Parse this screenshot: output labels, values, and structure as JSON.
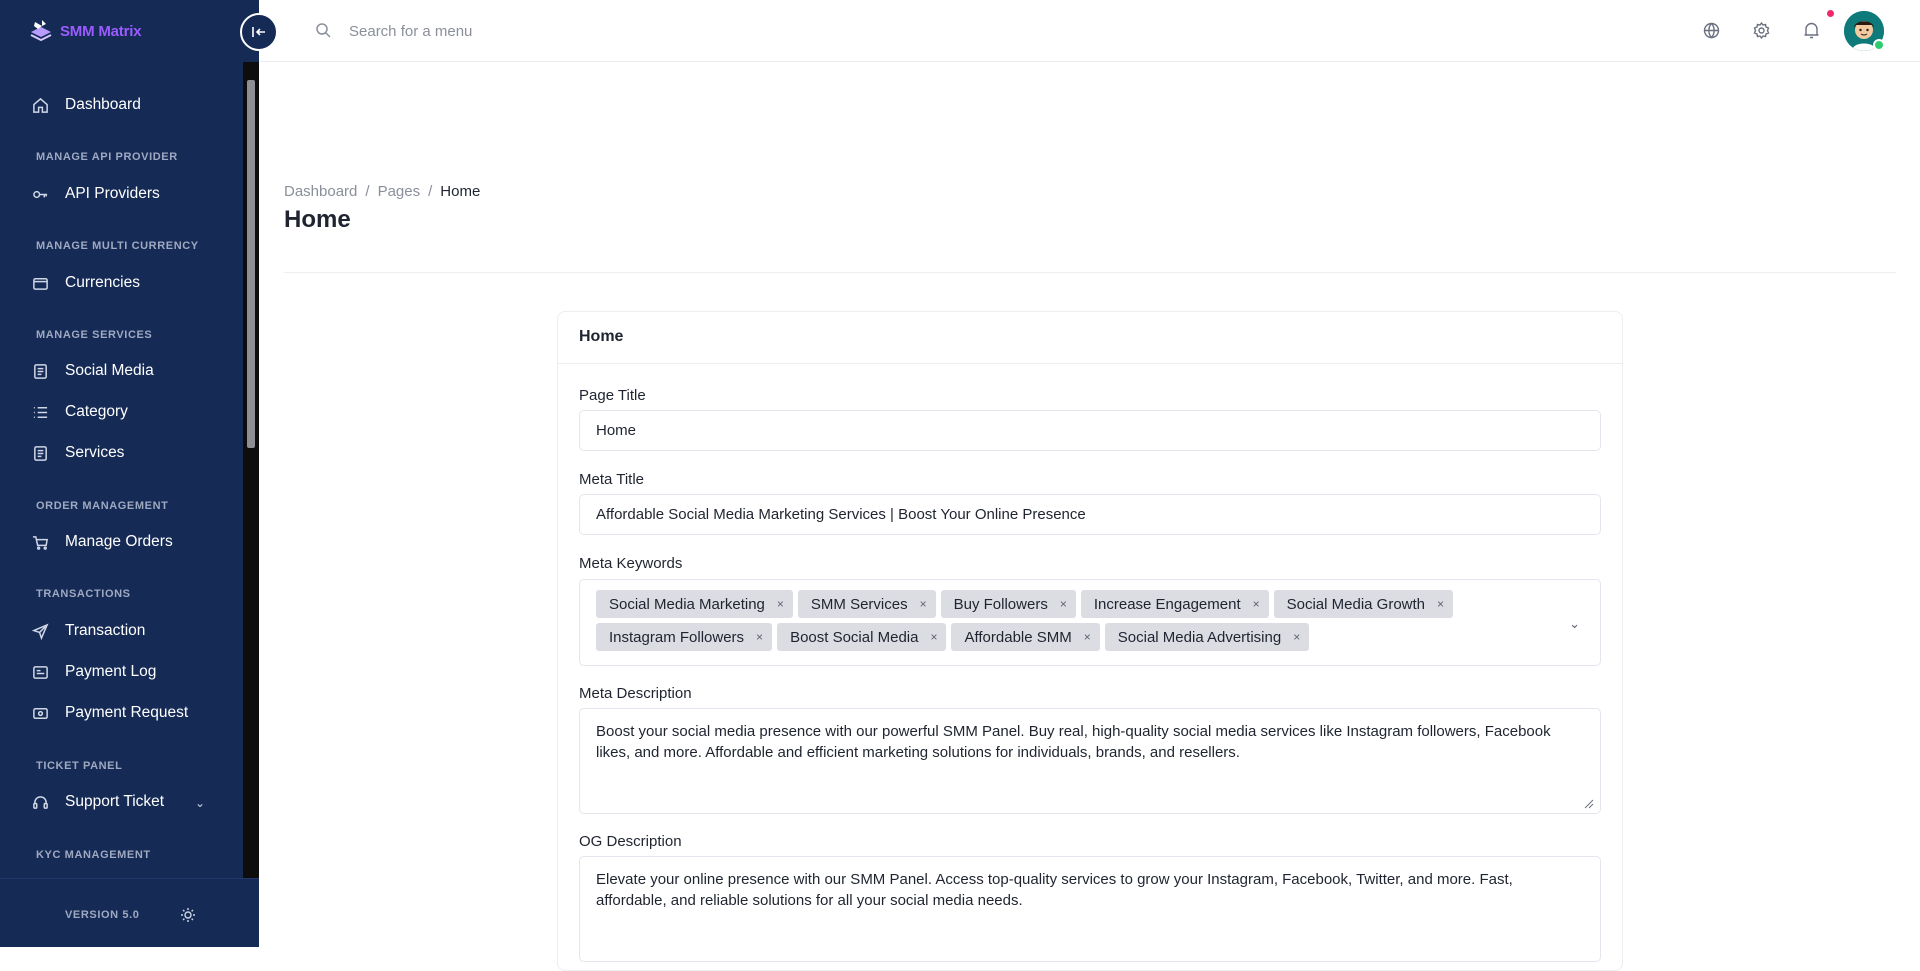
{
  "brand": {
    "name": "SMM Matrix"
  },
  "sidebar": {
    "items": [
      {
        "label": "Dashboard"
      },
      {
        "section": "MANAGE API PROVIDER"
      },
      {
        "label": "API Providers"
      },
      {
        "section": "MANAGE MULTI CURRENCY"
      },
      {
        "label": "Currencies"
      },
      {
        "section": "MANAGE SERVICES"
      },
      {
        "label": "Social Media"
      },
      {
        "label": "Category"
      },
      {
        "label": "Services"
      },
      {
        "section": "ORDER MANAGEMENT"
      },
      {
        "label": "Manage Orders"
      },
      {
        "section": "TRANSACTIONS"
      },
      {
        "label": "Transaction"
      },
      {
        "label": "Payment Log"
      },
      {
        "label": "Payment Request"
      },
      {
        "section": "TICKET PANEL"
      },
      {
        "label": "Support Ticket"
      },
      {
        "section": "KYC MANAGEMENT"
      }
    ],
    "version": "VERSION 5.0"
  },
  "topbar": {
    "search_placeholder": "Search for a menu"
  },
  "breadcrumb": [
    "Dashboard",
    "/",
    "Pages",
    "/",
    "Home"
  ],
  "page_title": "Home",
  "form": {
    "card_title": "Home",
    "page_title_label": "Page Title",
    "page_title_value": "Home",
    "meta_title_label": "Meta Title",
    "meta_title_value": "Affordable Social Media Marketing Services | Boost Your Online Presence",
    "meta_keywords_label": "Meta Keywords",
    "meta_keywords": [
      "Social Media Marketing",
      "SMM Services",
      "Buy Followers",
      "Increase Engagement",
      "Social Media Growth",
      "Instagram Followers",
      "Boost Social Media",
      "Affordable SMM",
      "Social Media Advertising"
    ],
    "tag_remove": "×",
    "meta_description_label": "Meta Description",
    "meta_description_value": "Boost your social media presence with our powerful SMM Panel. Buy real, high-quality social media services like Instagram followers, Facebook likes, and more. Affordable and efficient marketing solutions for individuals, brands, and resellers.",
    "og_description_label": "OG Description",
    "og_description_value": "Elevate your online presence with our SMM Panel. Access top-quality services to grow your Instagram, Facebook, Twitter, and more. Fast, affordable, and reliable solutions for all your social media needs."
  }
}
